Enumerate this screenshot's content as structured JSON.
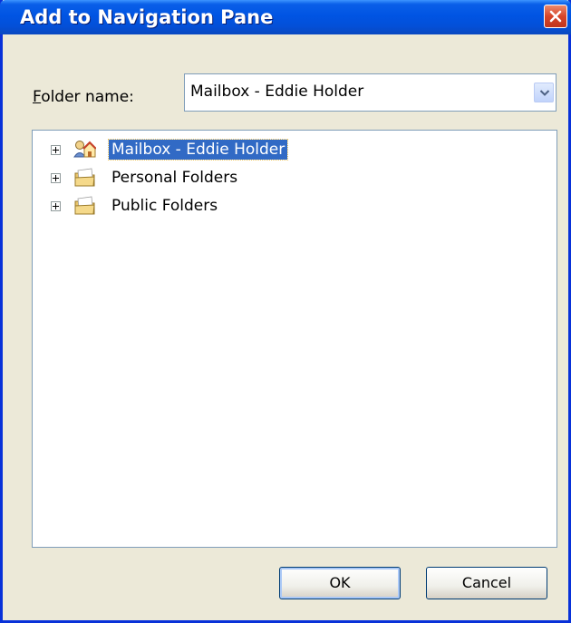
{
  "window": {
    "title": "Add to Navigation Pane"
  },
  "folder_name": {
    "label_accel": "F",
    "label_rest": "older name:",
    "value": "Mailbox - Eddie Holder"
  },
  "tree": {
    "items": [
      {
        "label": "Mailbox - Eddie Holder",
        "icon": "mailbox-icon",
        "selected": true
      },
      {
        "label": "Personal Folders",
        "icon": "folder-icon",
        "selected": false
      },
      {
        "label": "Public Folders",
        "icon": "folder-icon",
        "selected": false
      }
    ]
  },
  "buttons": {
    "ok": "OK",
    "cancel": "Cancel"
  },
  "colors": {
    "titlebar": "#0054e3",
    "dialog_bg": "#ece9d8",
    "selection": "#316ac5",
    "close": "#d6452a"
  }
}
